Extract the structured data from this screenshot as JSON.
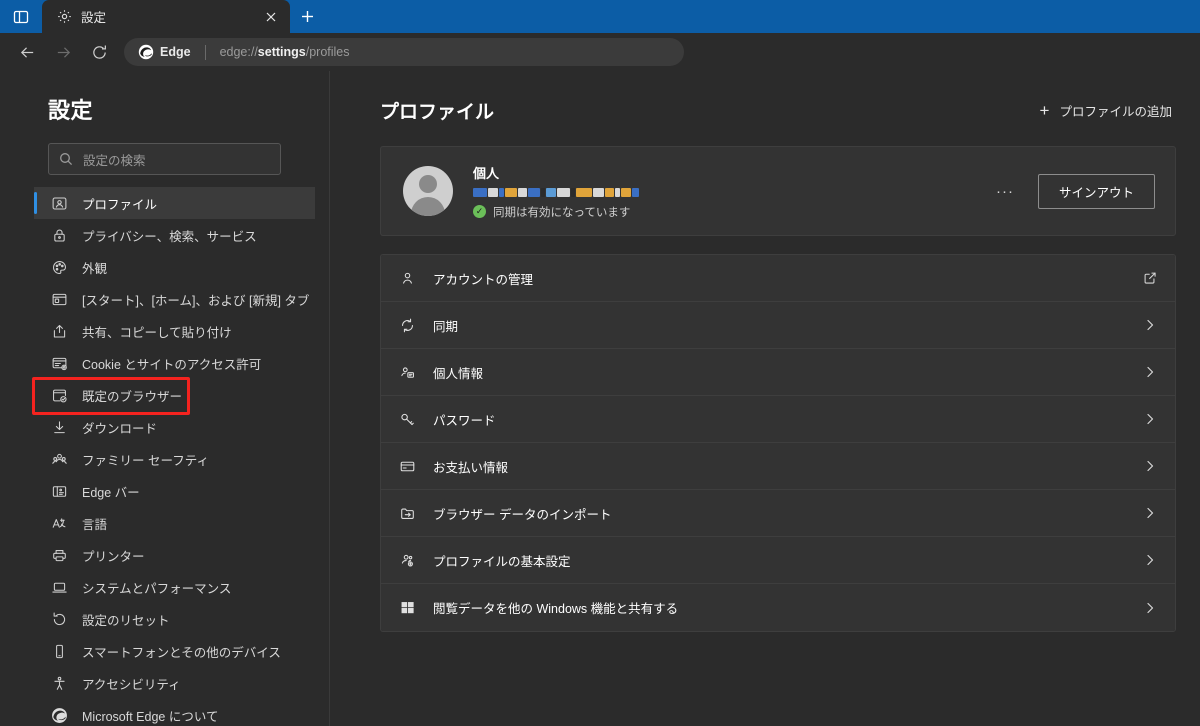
{
  "browser": {
    "tab_actions_icon": "tab-actions-icon",
    "tab": {
      "favicon": "gear-icon",
      "title": "設定",
      "close_icon": "close-icon"
    },
    "new_tab_label": "+",
    "toolbar": {
      "back_icon": "back-arrow-icon",
      "forward_icon": "forward-arrow-icon",
      "reload_icon": "reload-icon",
      "omnibox": {
        "brand_icon": "edge-logo-icon",
        "brand_label": "Edge",
        "url_prefix": "edge://",
        "url_bold": "settings",
        "url_suffix": "/profiles"
      }
    }
  },
  "sidebar": {
    "title": "設定",
    "search": {
      "placeholder": "設定の検索",
      "value": "",
      "icon": "search-icon"
    },
    "items": [
      {
        "label": "プロファイル",
        "icon": "profile-icon",
        "selected": true,
        "highlighted": false
      },
      {
        "label": "プライバシー、検索、サービス",
        "icon": "lock-icon",
        "selected": false,
        "highlighted": false
      },
      {
        "label": "外観",
        "icon": "palette-icon",
        "selected": false,
        "highlighted": false
      },
      {
        "label": "[スタート]、[ホーム]、および [新規] タブ",
        "icon": "browser-window-icon",
        "selected": false,
        "highlighted": false
      },
      {
        "label": "共有、コピーして貼り付け",
        "icon": "share-icon",
        "selected": false,
        "highlighted": false
      },
      {
        "label": "Cookie とサイトのアクセス許可",
        "icon": "cookie-permissions-icon",
        "selected": false,
        "highlighted": false
      },
      {
        "label": "既定のブラウザー",
        "icon": "default-browser-icon",
        "selected": false,
        "highlighted": true
      },
      {
        "label": "ダウンロード",
        "icon": "download-icon",
        "selected": false,
        "highlighted": false
      },
      {
        "label": "ファミリー セーフティ",
        "icon": "family-icon",
        "selected": false,
        "highlighted": false
      },
      {
        "label": "Edge バー",
        "icon": "edge-bar-icon",
        "selected": false,
        "highlighted": false
      },
      {
        "label": "言語",
        "icon": "language-icon",
        "selected": false,
        "highlighted": false
      },
      {
        "label": "プリンター",
        "icon": "printer-icon",
        "selected": false,
        "highlighted": false
      },
      {
        "label": "システムとパフォーマンス",
        "icon": "laptop-icon",
        "selected": false,
        "highlighted": false
      },
      {
        "label": "設定のリセット",
        "icon": "reset-icon",
        "selected": false,
        "highlighted": false
      },
      {
        "label": "スマートフォンとその他のデバイス",
        "icon": "phone-icon",
        "selected": false,
        "highlighted": false
      },
      {
        "label": "アクセシビリティ",
        "icon": "accessibility-icon",
        "selected": false,
        "highlighted": false
      },
      {
        "label": "Microsoft Edge について",
        "icon": "edge-logo-icon",
        "selected": false,
        "highlighted": false
      }
    ]
  },
  "main": {
    "title": "プロファイル",
    "add_profile_label": "プロファイルの追加",
    "add_profile_icon": "plus-icon",
    "profile_card": {
      "avatar_icon": "avatar-icon",
      "name": "個人",
      "email_redacted": true,
      "sync_status": "同期は有効になっています",
      "sync_icon": "check-circle-icon",
      "more_label": "···",
      "signout_label": "サインアウト"
    },
    "rows": [
      {
        "label": "アカウントの管理",
        "icon": "person-icon",
        "trail": "external-link-icon"
      },
      {
        "label": "同期",
        "icon": "sync-icon",
        "trail": "chevron-right-icon"
      },
      {
        "label": "個人情報",
        "icon": "person-card-icon",
        "trail": "chevron-right-icon"
      },
      {
        "label": "パスワード",
        "icon": "key-icon",
        "trail": "chevron-right-icon"
      },
      {
        "label": "お支払い情報",
        "icon": "credit-card-icon",
        "trail": "chevron-right-icon"
      },
      {
        "label": "ブラウザー データのインポート",
        "icon": "import-icon",
        "trail": "chevron-right-icon"
      },
      {
        "label": "プロファイルの基本設定",
        "icon": "profile-prefs-icon",
        "trail": "chevron-right-icon"
      },
      {
        "label": "閲覧データを他の Windows 機能と共有する",
        "icon": "windows-icon",
        "trail": "chevron-right-icon"
      }
    ]
  },
  "colors": {
    "accent_blue": "#0c5da6",
    "selected_indicator": "#2f8fe3",
    "highlight_red": "#f4231f",
    "sync_green": "#6bbf59",
    "page_bg": "#2b2b2b",
    "card_bg": "#333333"
  },
  "redaction_blocks": [
    {
      "w": 14,
      "c": "#3a6fc4"
    },
    {
      "w": 10,
      "c": "#d8d8d8"
    },
    {
      "w": 5,
      "c": "#3a6fc4"
    },
    {
      "w": 12,
      "c": "#e0a43a"
    },
    {
      "w": 9,
      "c": "#d8d8d8"
    },
    {
      "w": 12,
      "c": "#3a6fc4"
    },
    {
      "w": 4,
      "c": "#2b2b2b"
    },
    {
      "w": 10,
      "c": "#5b9bd5"
    },
    {
      "w": 13,
      "c": "#d8d8d8"
    },
    {
      "w": 4,
      "c": "#2b2b2b"
    },
    {
      "w": 16,
      "c": "#e0a43a"
    },
    {
      "w": 11,
      "c": "#d8d8d8"
    },
    {
      "w": 9,
      "c": "#e0a43a"
    },
    {
      "w": 5,
      "c": "#d8d8d8"
    },
    {
      "w": 10,
      "c": "#e0a43a"
    },
    {
      "w": 7,
      "c": "#3a6fc4"
    }
  ]
}
